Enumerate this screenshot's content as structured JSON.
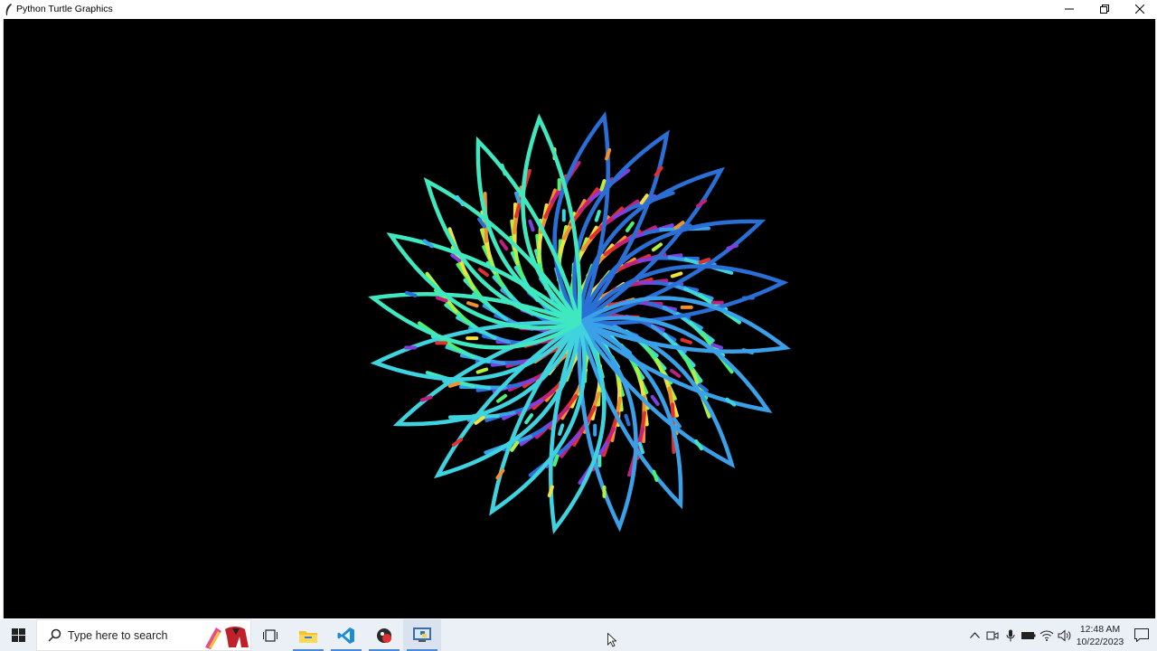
{
  "window": {
    "title": "Python Turtle Graphics",
    "icon": "python-feather-icon",
    "controls": [
      "minimize-icon",
      "restore-icon",
      "close-icon"
    ]
  },
  "canvas": {
    "background": "#000000",
    "drawing": {
      "petals": 20,
      "colors": [
        "#2a6fd6",
        "#3aa0e8",
        "#3fd3e0",
        "#40e8c0",
        "#50f070",
        "#b0f040",
        "#f0e040",
        "#f09030",
        "#e03030",
        "#c02080",
        "#8040e0"
      ]
    }
  },
  "taskbar": {
    "start_icon": "windows-start-icon",
    "search_placeholder": "Type here to search",
    "apps": [
      "task-view-icon",
      "file-explorer-icon",
      "vscode-icon",
      "app-icon",
      "python-turtle-icon"
    ],
    "tray_icons": [
      "chevron-up-icon",
      "meet-now-icon",
      "microphone-icon",
      "battery-icon",
      "wifi-icon",
      "volume-icon"
    ],
    "time": "12:48 AM",
    "date": "10/22/2023",
    "notification_icon": "notification-icon"
  }
}
